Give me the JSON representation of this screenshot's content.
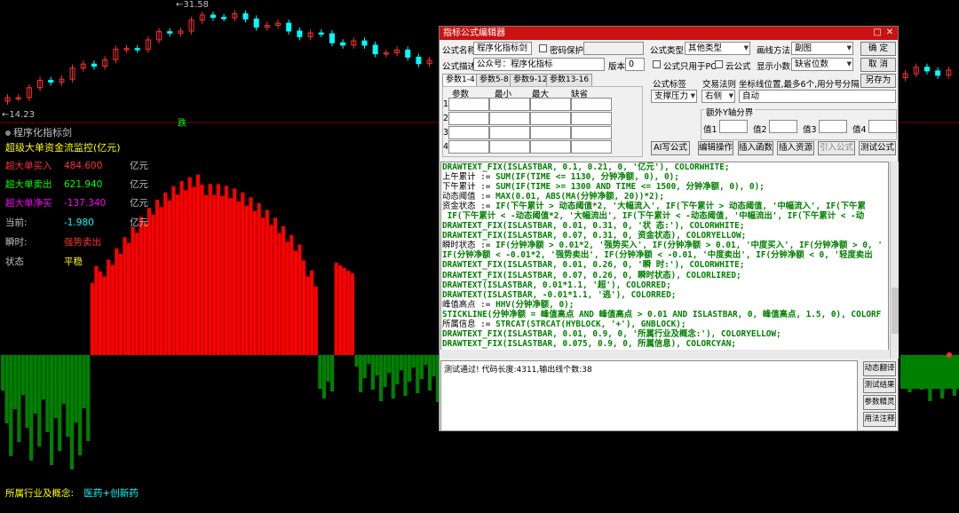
{
  "chart": {
    "high_label": "31.58",
    "low_label": "14.23",
    "signal_tag": "跌",
    "subchart_title": "程序化指标剑",
    "monitor_title": "超级大单资金流监控(亿元)",
    "rows": [
      {
        "label": "超大单买入",
        "value": "484.600",
        "unit": "亿元",
        "color": "#ff3030",
        "value_color": "#ff3030"
      },
      {
        "label": "超大单卖出",
        "value": "621.940",
        "unit": "亿元",
        "color": "#00ff00",
        "value_color": "#00ff00"
      },
      {
        "label": "超大单净买",
        "value": "-137.340",
        "unit": "亿元",
        "color": "#ff00ff",
        "value_color": "#ff00ff"
      },
      {
        "label": "当前:",
        "value": "-1.980",
        "unit": "亿元",
        "color": "#c0c0c0",
        "value_color": "#00ffff"
      },
      {
        "label": "瞬时:",
        "value": "强势卖出",
        "unit": "",
        "color": "#c0c0c0",
        "value_color": "#ff3030"
      },
      {
        "label": "状态",
        "value": "平稳",
        "unit": "",
        "color": "#c0c0c0",
        "value_color": "#ffff00"
      }
    ],
    "industry_label": "所属行业及概念:",
    "industry_value": "医药+创新药",
    "colors": {
      "up": "#ff3030",
      "down": "#00ffff",
      "red_bar": "#ff0000",
      "green_bar": "#008000"
    }
  },
  "dialog": {
    "title": "指标公式编辑器",
    "formula_name_label": "公式名称",
    "formula_name_value": "程序化指标剑",
    "password_label": "密码保护",
    "formula_desc_label": "公式描述",
    "formula_desc_value": "公众号：程序化指标",
    "version_label": "版本",
    "version_value": "0",
    "formula_type_label": "公式类型",
    "formula_type_value": "其他类型",
    "draw_method_label": "画线方法",
    "draw_method_value": "副图",
    "ok_label": "确 定",
    "cancel_label": "取 消",
    "save_as_label": "另存为",
    "pc_only_label": "公式只用于PC",
    "cloud_label": "云公式",
    "decimals_label": "显示小数",
    "decimals_value": "缺省位数",
    "tabs": [
      "参数1-4",
      "参数5-8",
      "参数9-12",
      "参数13-16"
    ],
    "param_headers": [
      "参数",
      "最小",
      "最大",
      "缺省"
    ],
    "param_rows": [
      "1",
      "2",
      "3",
      "4"
    ],
    "formula_tag_label": "公式标签",
    "formula_tag_value": "支撑压力",
    "trade_rule_label": "交易法则",
    "trade_rule_value": "右侧",
    "axis_pos_label": "坐标线位置,最多6个,用分号分隔",
    "axis_pos_value": "自动",
    "extra_y_label": "额外Y轴分界",
    "values": [
      "值1",
      "值2",
      "值3",
      "值4"
    ],
    "buttons": [
      "AI写公式",
      "编辑操作",
      "插入函数",
      "插入资源",
      "引入公式",
      "测试公式"
    ],
    "status_text": "测试通过! 代码长度:4311,输出线个数:38",
    "side_buttons": [
      "动态翻译",
      "测试结果",
      "参数精灵",
      "用法注释"
    ]
  },
  "code": [
    [
      [
        "DRAWTEXT_FIX(ISLASTBAR, 0.1, 0.21, 0, '亿元'), COLORWHITE;",
        "kw"
      ]
    ],
    [
      [
        "上午累计 := ",
        "tx"
      ],
      [
        "SUM(IF(TIME <= 1130, 分钟净额, 0), 0);",
        "kw"
      ]
    ],
    [
      [
        "下午累计 := ",
        "tx"
      ],
      [
        "SUM(IF(TIME >= 1300 AND TIME <= 1500, 分钟净额, 0), 0);",
        "kw"
      ]
    ],
    [
      [
        "动态阈值 := ",
        "tx"
      ],
      [
        "MAX(0.01, ABS(MA(分钟净额, 20))*2);",
        "kw"
      ]
    ],
    [
      [
        "资金状态 := ",
        "tx"
      ],
      [
        "IF(下午累计 > 动态阈值*2, '大幅流入', IF(下午累计 > 动态阈值, '中幅流入', IF(下午累",
        "kw"
      ]
    ],
    [
      [
        " IF(下午累计 < -动态阈值*2, '大幅流出', IF(下午累计 < -动态阈值, '中幅流出', IF(下午累计 < -动",
        "kw"
      ]
    ],
    [
      [
        "DRAWTEXT_FIX(ISLASTBAR, 0.01, 0.31, 0, '状 态:'), COLORWHITE;",
        "kw"
      ]
    ],
    [
      [
        "DRAWTEXT_FIX(ISLASTBAR, 0.07, 0.31, 0, 资金状态), COLORYELLOW;",
        "kw"
      ]
    ],
    [
      [
        "瞬时状态 := ",
        "tx"
      ],
      [
        "IF(分钟净额 > 0.01*2, '强势买入', IF(分钟净额 > 0.01, '中度买入', IF(分钟净额 > 0, '",
        "kw"
      ]
    ],
    [
      [
        "IF(分钟净额 < -0.01*2, '强势卖出', IF(分钟净额 < -0.01, '中度卖出', IF(分钟净额 < 0, '轻度卖出",
        "kw"
      ]
    ],
    [
      [
        "DRAWTEXT_FIX(ISLASTBAR, 0.01, 0.26, 0, '瞬 时:'), COLORWHITE;",
        "kw"
      ]
    ],
    [
      [
        "DRAWTEXT_FIX(ISLASTBAR, 0.07, 0.26, 0, 瞬时状态), COLORLIRED;",
        "kw"
      ]
    ],
    [
      [
        "DRAWTEXT(ISLASTBAR, 0.01*1.1, '超'), COLORRED;",
        "kw"
      ]
    ],
    [
      [
        "DRAWTEXT(ISLASTBAR, -0.01*1.1, '逃'), COLORRED;",
        "kw"
      ]
    ],
    [
      [
        "峰值高点 := ",
        "tx"
      ],
      [
        "HHV(分钟净额, 0);",
        "kw"
      ]
    ],
    [
      [
        "STICKLINE(分钟净额 = 峰值高点 AND 峰值高点 > 0.01 AND ISLASTBAR, 0, 峰值高点, 1.5, 0), COLORF",
        "kw"
      ]
    ],
    [
      [
        "所属信息 := ",
        "tx"
      ],
      [
        "STRCAT(STRCAT(HYBLOCK, '+'), GNBLOCK);",
        "kw"
      ]
    ],
    [
      [
        "DRAWTEXT_FIX(ISLASTBAR, 0.01, 0.9, 0, '所属行业及概念:'), COLORYELLOW;",
        "kw"
      ]
    ],
    [
      [
        "DRAWTEXT_FIX(ISLASTBAR, 0.075, 0.9, 0, 所属信息), COLORCYAN;",
        "kw"
      ]
    ]
  ]
}
